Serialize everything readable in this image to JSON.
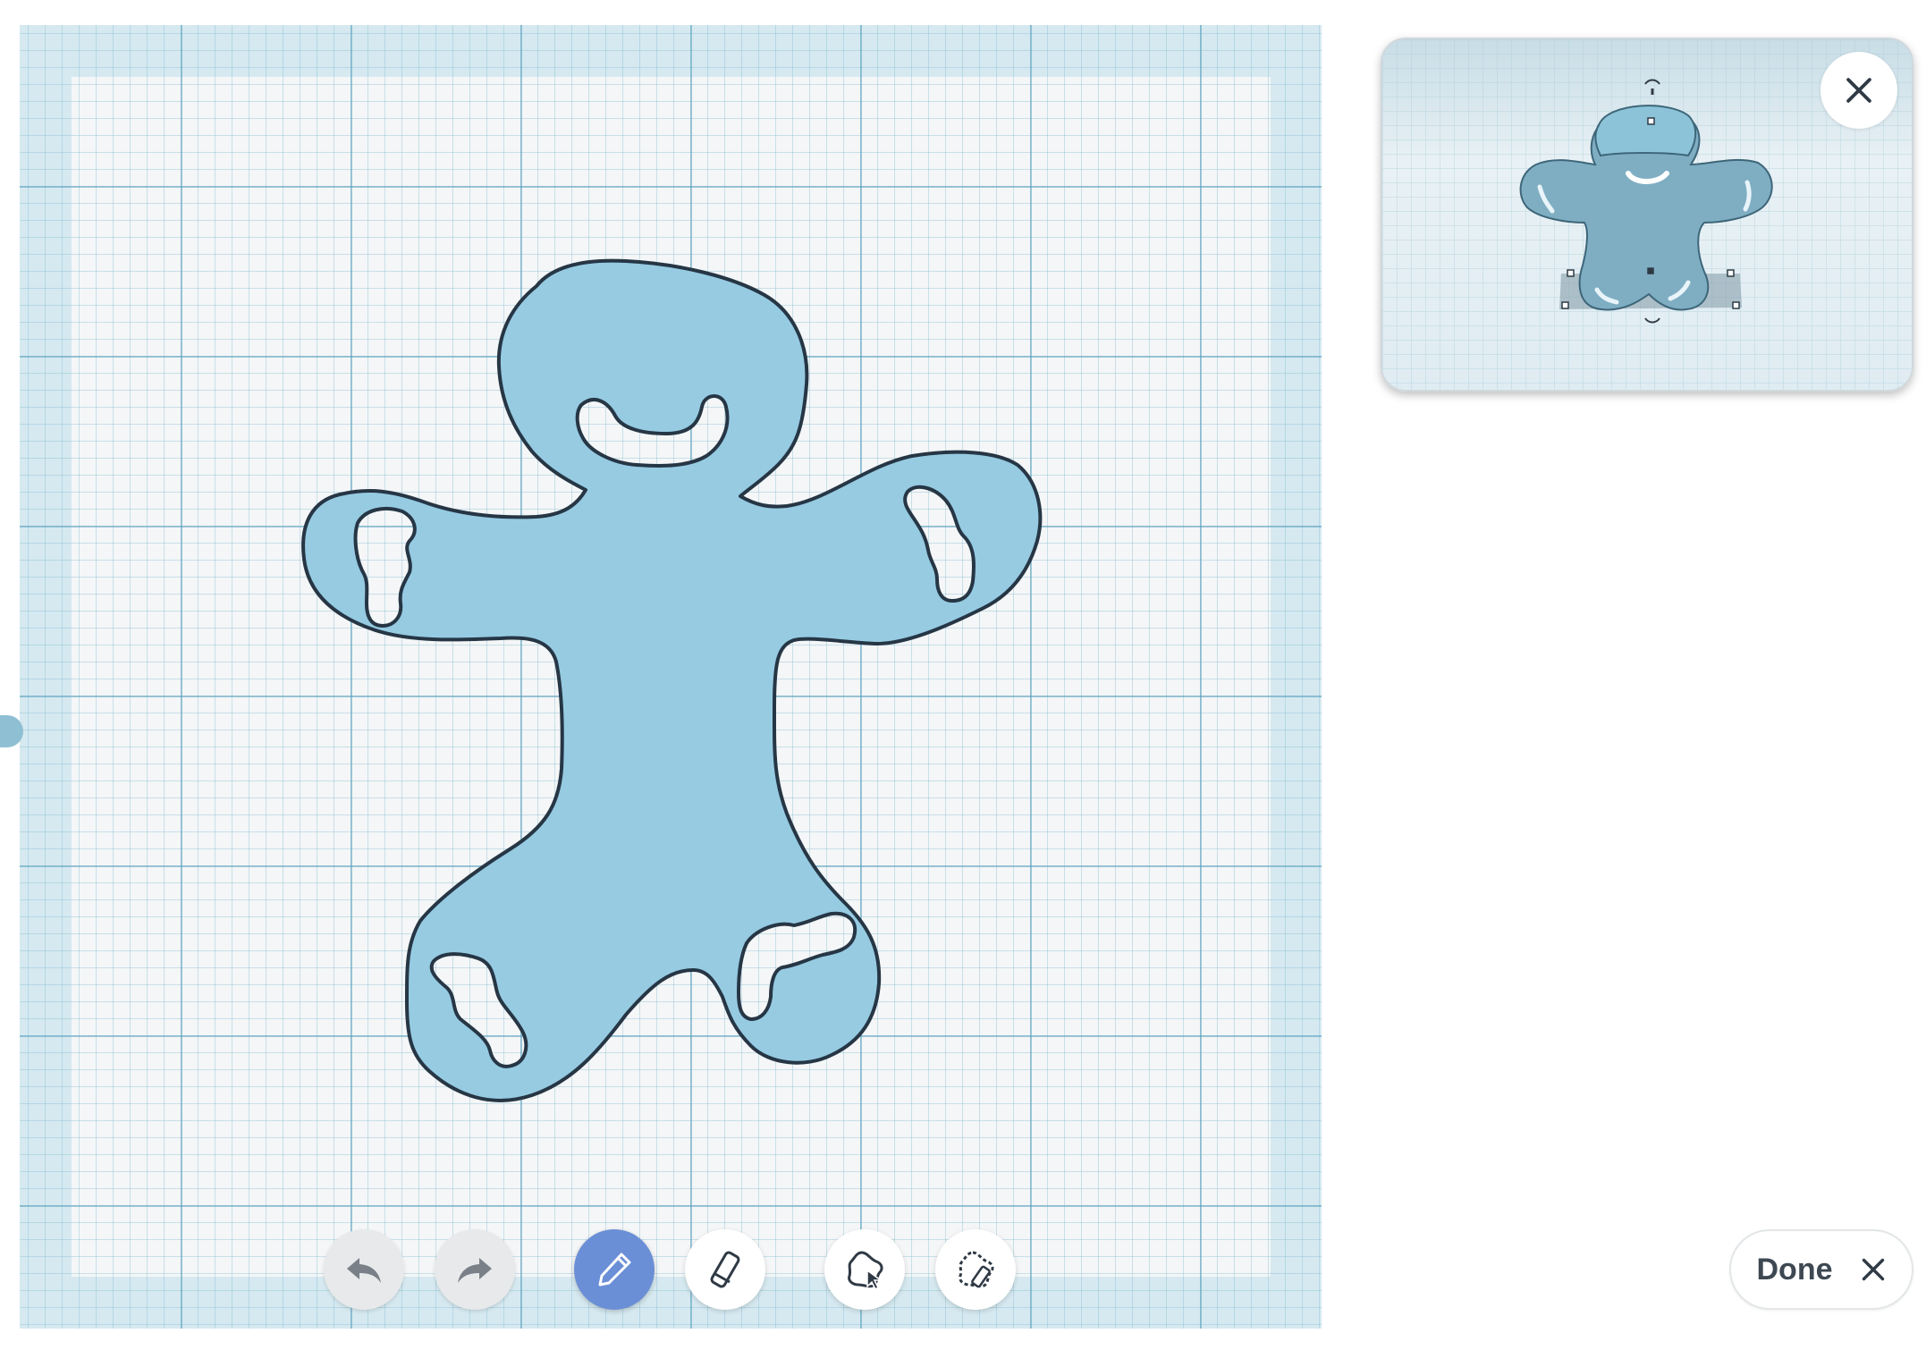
{
  "app": {
    "accent_color": "#6b8fd6",
    "shape_fill": "#96cbe2",
    "shape_stroke": "#263645",
    "canvas_grid_color": "#5aa0be"
  },
  "toolbar": {
    "items": [
      {
        "name": "undo-button",
        "icon": "undo-arrow-icon",
        "state": "disabled"
      },
      {
        "name": "redo-button",
        "icon": "redo-arrow-icon",
        "state": "disabled"
      },
      {
        "name": "pencil-tool-button",
        "icon": "pencil-icon",
        "state": "active"
      },
      {
        "name": "eraser-tool-button",
        "icon": "eraser-icon",
        "state": "normal"
      },
      {
        "name": "select-shape-tool-button",
        "icon": "select-shape-icon",
        "state": "normal"
      },
      {
        "name": "erase-shape-tool-button",
        "icon": "erase-shape-icon",
        "state": "normal"
      }
    ]
  },
  "preview": {
    "close_icon": "close-icon"
  },
  "done_button": {
    "label": "Done",
    "icon": "close-icon"
  }
}
